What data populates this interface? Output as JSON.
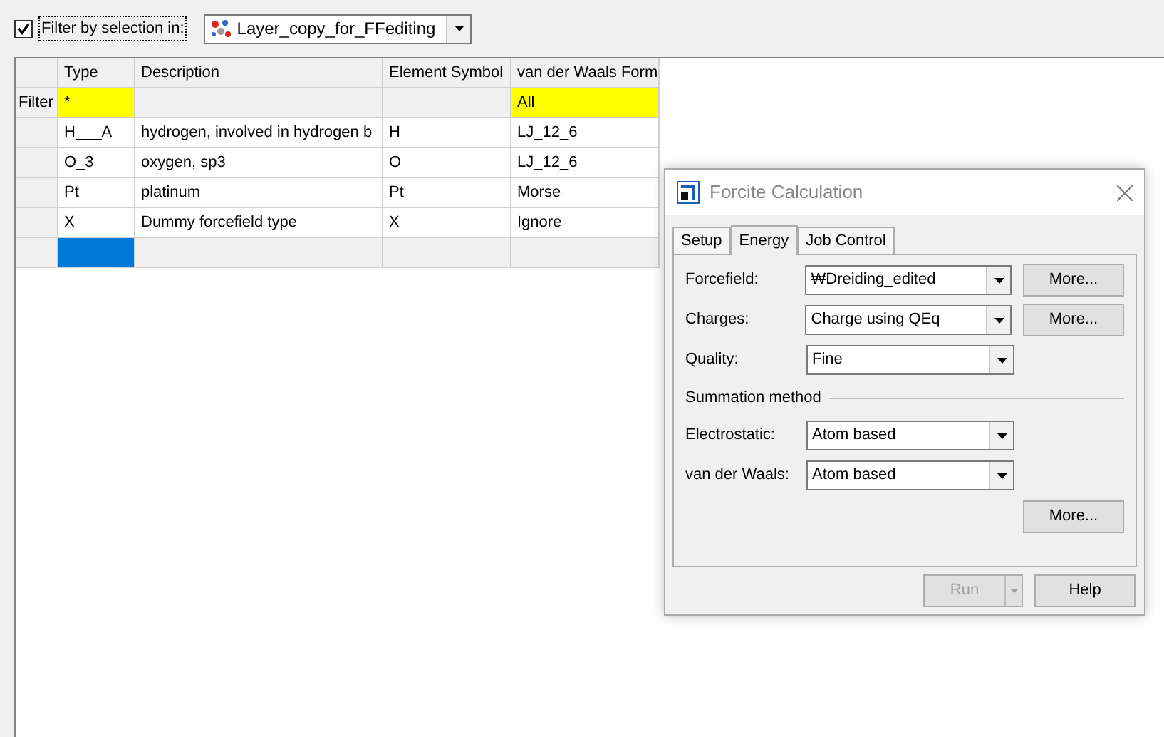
{
  "filter_bar": {
    "checkbox": {
      "label": "Filter by selection in:",
      "checked": true
    },
    "layer": {
      "value": "Layer_copy_for_FFediting"
    }
  },
  "table": {
    "columns": [
      "Type",
      "Description",
      "Element Symbol",
      "van der Waals Form"
    ],
    "filter_row": {
      "label": "Filter",
      "cells": [
        {
          "text": "*",
          "active": true
        },
        {
          "active": false
        },
        {
          "active": false
        },
        {
          "text": "All",
          "active": true
        }
      ]
    },
    "rows": [
      {
        "cells": [
          "H___A",
          "hydrogen, involved in hydrogen b",
          "H",
          "LJ_12_6"
        ]
      },
      {
        "cells": [
          "O_3",
          "oxygen, sp3",
          "O",
          "LJ_12_6"
        ]
      },
      {
        "cells": [
          "Pt",
          "platinum",
          "Pt",
          "Morse"
        ]
      },
      {
        "cells": [
          "X",
          "Dummy forcefield type",
          "X",
          "Ignore"
        ]
      }
    ],
    "new_row": {
      "cells": [
        {
          "selected": true
        },
        {
          "selected": false
        },
        {
          "selected": false
        },
        {
          "selected": false
        }
      ]
    }
  },
  "dialog": {
    "title": "Forcite Calculation",
    "tabs": [
      {
        "label": "Setup",
        "selected": false
      },
      {
        "label": "Energy",
        "selected": true
      },
      {
        "label": "Job Control",
        "selected": false
      }
    ],
    "fields": [
      {
        "label": "Forcefield:",
        "value": "₩Dreiding_edited",
        "more": "More..."
      },
      {
        "label": "Charges:",
        "value": "Charge using QEq",
        "more": "More..."
      },
      {
        "label": "Quality:",
        "value": "Fine"
      }
    ],
    "section": "Summation method",
    "summation_fields": [
      {
        "label": "Electrostatic:",
        "value": "Atom based"
      },
      {
        "label": "van der Waals:",
        "value": "Atom based"
      }
    ],
    "section_more": "More...",
    "buttons": [
      {
        "label": "Run",
        "disabled": true,
        "kind": "split"
      },
      {
        "label": "Help",
        "disabled": false,
        "kind": "plain"
      }
    ]
  }
}
